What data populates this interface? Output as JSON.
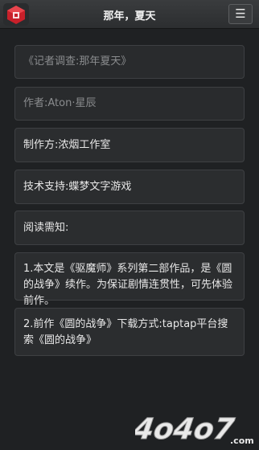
{
  "header": {
    "title": "那年，夏天",
    "menu_glyph": "☰"
  },
  "cards": [
    {
      "text": "《记者调查:那年夏天》"
    },
    {
      "text": "作者:Aton·星辰"
    },
    {
      "text": "制作方:浓烟工作室"
    },
    {
      "text": "技术支持:蝶梦文字游戏"
    },
    {
      "text": "阅读需知:"
    },
    {
      "text": "1.本文是《驱魔师》系列第二部作品，是《圆的战争》续作。为保证剧情连贯性，可先体验前作。"
    },
    {
      "text": "2.前作《圆的战争》下载方式:taptap平台搜索《圆的战争》"
    }
  ],
  "watermark": {
    "text": "4o4o7",
    "suffix": ".com"
  }
}
